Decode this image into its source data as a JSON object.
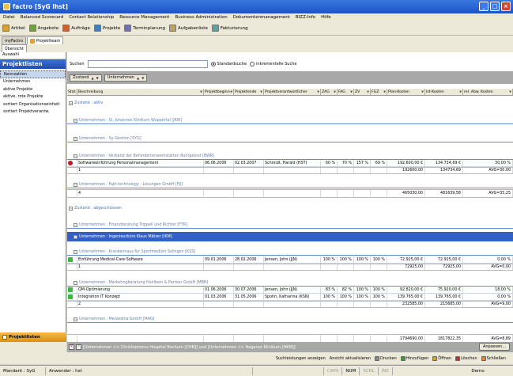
{
  "window": {
    "title": "factro [SyG Ihst]"
  },
  "menu": [
    "Datei",
    "Balanced Scorecard",
    "Contact Relationship",
    "Resource Management",
    "Business Administration",
    "Dokumentenmanagement",
    "BIZZ-Info",
    "Hilfe"
  ],
  "toolbar": [
    {
      "label": "Artikel",
      "icon": "article-icon",
      "color": "#d8a030"
    },
    {
      "label": "Angebote",
      "icon": "offer-icon",
      "color": "#70a040"
    },
    {
      "label": "Aufträge",
      "icon": "order-icon",
      "color": "#d06030"
    },
    {
      "label": "Projekte",
      "icon": "project-icon",
      "color": "#4080c0"
    },
    {
      "label": "Terminplanung",
      "icon": "schedule-icon",
      "color": "#7070b0"
    },
    {
      "label": "Aufgabenliste",
      "icon": "tasklist-icon",
      "color": "#c0a060"
    },
    {
      "label": "Fakturierung",
      "icon": "invoice-icon",
      "color": "#60a0a0"
    }
  ],
  "tabs": [
    "myFactro",
    "Projektteam"
  ],
  "subtabs": [
    "Übersicht"
  ],
  "left": {
    "auswahl": "Auswahl",
    "heading": "Projektlisten",
    "items": [
      "Kennzahlen",
      "Unternehmen",
      "aktive Projekte",
      "aktive, rote Projekte",
      "sortiert Organisationseinheit",
      "sortiert Projektverantw."
    ],
    "bottom": "Projektlisten"
  },
  "search": {
    "label": "Suchen",
    "value": "",
    "radio1": "Standardsuche",
    "radio2": "inkrementelle Suche"
  },
  "grouping": [
    "Zustand",
    "Unternehmen"
  ],
  "columns": [
    "Stat.",
    "Beschreibung",
    "Projektbeginn",
    "Projektende",
    "Projektverantwortlicher",
    "ZAG",
    "FAG",
    "ZV",
    "FGZ",
    "Plan-Kosten",
    "Ist-Kosten",
    "rel. Abw. Kosten"
  ],
  "rows": [
    {
      "kind": "group0",
      "text": "Zustand : aktiv"
    },
    {
      "kind": "group1",
      "text": "Unternehmen : St. Johannes Klinikum Wuppertal [JKW]"
    },
    {
      "kind": "group1",
      "text": "Unternehmen : Sy-Gestion [SYG]"
    },
    {
      "kind": "group1",
      "text": "Unternehmen : Verband der Behindertenwerkstätten Ruhrgebiet [BWR]"
    },
    {
      "kind": "data",
      "status": "#c81818",
      "cells": [
        "Softwareeinführung Personalmanagement",
        "06.06.2006",
        "02.03.2007",
        "Schmidt, Harald (HST)",
        "60 %",
        "70 %",
        "157 %",
        "69 %",
        "192.600,00 €",
        "134.734,69 €",
        "30,00 %"
      ]
    },
    {
      "kind": "sum",
      "cells": [
        "1",
        "",
        "",
        "",
        "",
        "",
        "",
        "",
        "192600,00",
        "134734,69",
        "AVG=30,00"
      ]
    },
    {
      "kind": "group1",
      "text": "Unternehmen : Fajit-technology - Lösungen GmbH [FJI]"
    },
    {
      "kind": "sum",
      "cells": [
        "4",
        "",
        "",
        "",
        "",
        "",
        "",
        "",
        "465030,00",
        "481639,58",
        "AVG=35,25"
      ]
    },
    {
      "kind": "group0",
      "text": "Zustand : abgeschlossen"
    },
    {
      "kind": "group1",
      "text": "Unternehmen : Finanzberatung Trippell und Richter [FTR]"
    },
    {
      "kind": "group1sel",
      "text": "Unternehmen : Ingenieurbüro Klaus Mätzer [IKM]"
    },
    {
      "kind": "group1",
      "text": "Unternehmen : Krankenhaus für Sportmedizin Solingen [KSS]"
    },
    {
      "kind": "data",
      "status": "#3cb83c",
      "cells": [
        "Einführung Medical-Care-Software",
        "09.01.2006",
        "28.02.2006",
        "Jensen, John (JJN)",
        "100 %",
        "100 %",
        "100 %",
        "100 %",
        "72.925,00 €",
        "72.925,00 €",
        "0,00 %"
      ]
    },
    {
      "kind": "sum",
      "cells": [
        "1",
        "",
        "",
        "",
        "",
        "",
        "",
        "",
        "72925,00",
        "72925,00",
        "AVG=0,00"
      ]
    },
    {
      "kind": "group1",
      "text": "Unternehmen : Marketingberatung Hohlbein & Partner GmbH [MBH]"
    },
    {
      "kind": "data",
      "status": "#3cb83c",
      "cells": [
        "QM-Optimierung",
        "01.06.2006",
        "30.07.2006",
        "Jensen, John (JJN)",
        "83 %",
        "82 %",
        "100 %",
        "100 %",
        "92.820,00 €",
        "75.920,00 €",
        "18,00 %"
      ]
    },
    {
      "kind": "data",
      "status": "#3cb83c",
      "cells": [
        "Integration IT Konzept",
        "01.03.2006",
        "31.05.2006",
        "Spohn, Katharina (KSN)",
        "100 %",
        "100 %",
        "100 %",
        "100 %",
        "139.765,00 €",
        "139.765,00 €",
        "0,00 %"
      ]
    },
    {
      "kind": "sum",
      "cells": [
        "2",
        "",
        "",
        "",
        "",
        "",
        "",
        "",
        "232585,00",
        "215685,00",
        "AVG=9,00"
      ]
    },
    {
      "kind": "group1",
      "text": "Unternehmen : Merzedina GmbH [MAG]"
    },
    {
      "kind": "sum",
      "cells": [
        "",
        "",
        "",
        "",
        "",
        "",
        "",
        "",
        "1794690,00",
        "1817822,35",
        "AVG=8,89"
      ]
    }
  ],
  "filter": {
    "text": "[Unternehmen <> Christophorus Hospital Bochum [CHB]] und [Unternehmen <> Hagener Klinikum [HKM]]",
    "button": "Anpassen..."
  },
  "actions": [
    "Suchleistungen anzeigen",
    "Ansicht aktualisieren",
    "Drucken",
    "Hinzufügen",
    "Öffnen",
    "Löschen",
    "Schließen"
  ],
  "statusbar": {
    "mandant": "Mandant : SyG",
    "anwender": "Anwender : hst",
    "caps": "CAPS",
    "num": "NUM",
    "scrl": "SCRL",
    "ins": "INS",
    "demo": "Demo"
  }
}
